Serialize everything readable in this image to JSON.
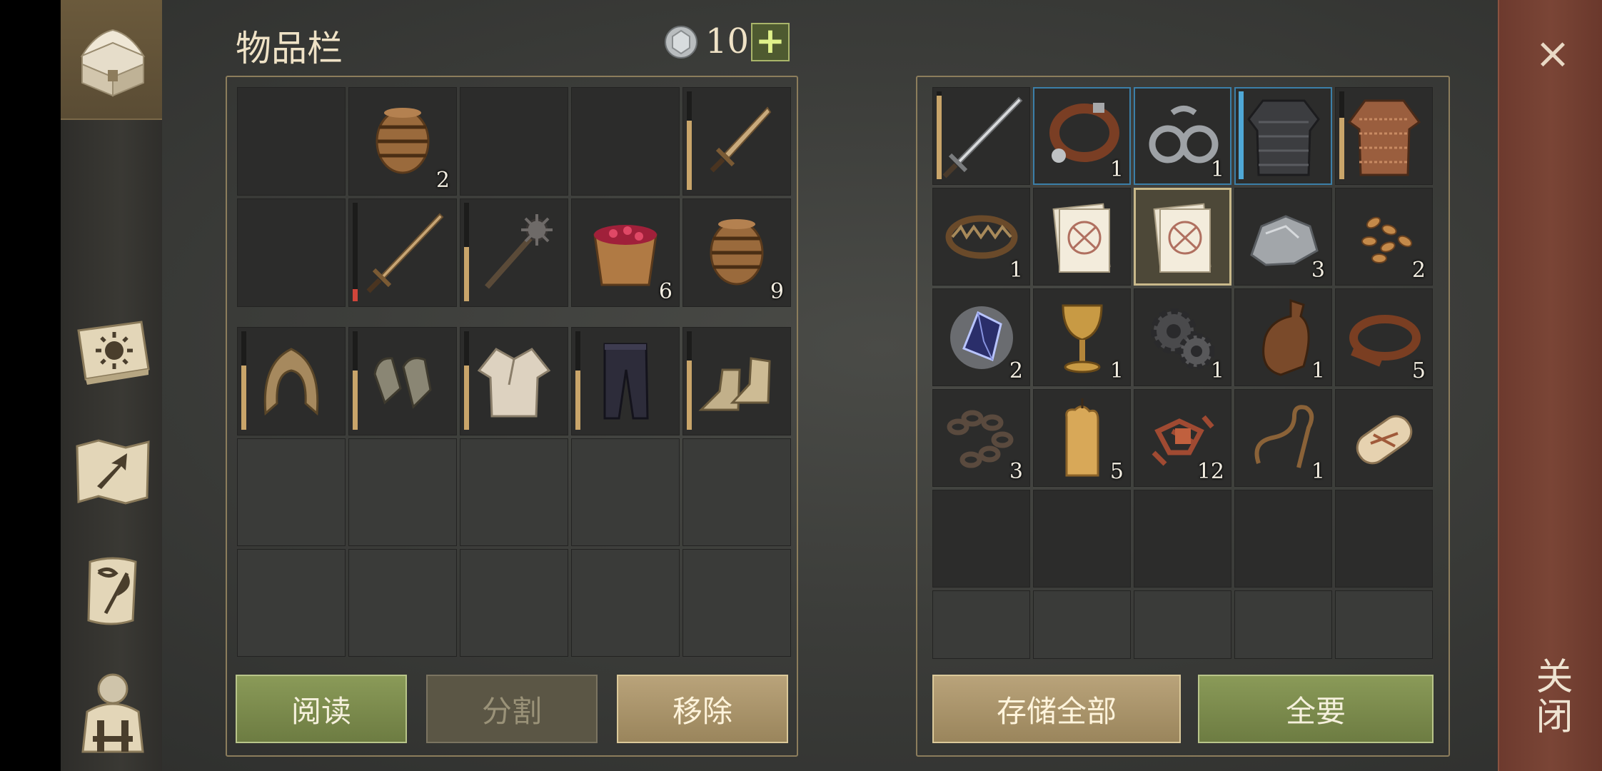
{
  "header": {
    "title": "物品栏",
    "coin_count": "10",
    "add_label": "+"
  },
  "close": {
    "x_label": "×",
    "label": "关闭"
  },
  "sidebar": {
    "items": [
      {
        "name": "chest-icon"
      },
      {
        "name": "sun-book-icon"
      },
      {
        "name": "map-arrow-icon"
      },
      {
        "name": "scroll-quill-icon"
      },
      {
        "name": "character-backpack-icon"
      }
    ]
  },
  "inventory": {
    "top_slots": [
      {
        "item": "",
        "qty": ""
      },
      {
        "item": "barrel-icon",
        "qty": "2"
      },
      {
        "item": "",
        "qty": ""
      },
      {
        "item": "",
        "qty": ""
      },
      {
        "item": "short-sword-icon",
        "qty": "",
        "durability": 0.7
      },
      {
        "item": "",
        "qty": ""
      },
      {
        "item": "long-sword-icon",
        "qty": "",
        "durability": 0.12,
        "low": true
      },
      {
        "item": "mace-icon",
        "qty": "",
        "durability": 0.55
      },
      {
        "item": "berry-bucket-icon",
        "qty": "6"
      },
      {
        "item": "barrel-icon",
        "qty": "9"
      }
    ],
    "equip_slots": [
      {
        "item": "hood-icon",
        "durability": 0.65
      },
      {
        "item": "gloves-icon",
        "durability": 0.6
      },
      {
        "item": "shirt-icon",
        "durability": 0.65
      },
      {
        "item": "pants-icon",
        "durability": 0.6
      },
      {
        "item": "boots-icon",
        "durability": 0.7
      }
    ]
  },
  "storage": {
    "slots": [
      {
        "item": "sword-icon",
        "qty": "",
        "durability": 0.95
      },
      {
        "item": "collar-icon",
        "qty": "1",
        "highlight": "blue"
      },
      {
        "item": "shackles-icon",
        "qty": "1",
        "highlight": "blue"
      },
      {
        "item": "chain-armor-icon",
        "qty": "",
        "highlight": "blue",
        "durability": 1.0,
        "bar_color": "#4fa8d6"
      },
      {
        "item": "mail-shirt-icon",
        "qty": "",
        "durability": 0.7
      },
      {
        "item": "bear-trap-icon",
        "qty": "1"
      },
      {
        "item": "recipe-paper-icon",
        "qty": ""
      },
      {
        "item": "recipe-paper-icon",
        "qty": "",
        "selected": true
      },
      {
        "item": "iron-ore-icon",
        "qty": "3"
      },
      {
        "item": "seeds-icon",
        "qty": "2"
      },
      {
        "item": "crystal-icon",
        "qty": "2"
      },
      {
        "item": "goblet-icon",
        "qty": "1"
      },
      {
        "item": "gears-icon",
        "qty": "1"
      },
      {
        "item": "leather-flask-icon",
        "qty": "1"
      },
      {
        "item": "leather-strap-icon",
        "qty": "5"
      },
      {
        "item": "chain-icon",
        "qty": "3"
      },
      {
        "item": "candle-icon",
        "qty": "5"
      },
      {
        "item": "copper-scrap-icon",
        "qty": "12"
      },
      {
        "item": "rope-icon",
        "qty": "1"
      },
      {
        "item": "scroll-roll-icon",
        "qty": ""
      }
    ]
  },
  "buttons": {
    "read": "阅读",
    "split": "分割",
    "remove": "移除",
    "store_all": "存储全部",
    "take_all": "全要"
  },
  "colors": {
    "accent_green": "#7a8a4c",
    "accent_tan": "#a99268",
    "close_red": "#74402f",
    "durability": "#c9a56a",
    "durability_low": "#d0453a",
    "rare_blue": "#3b7fa8"
  }
}
